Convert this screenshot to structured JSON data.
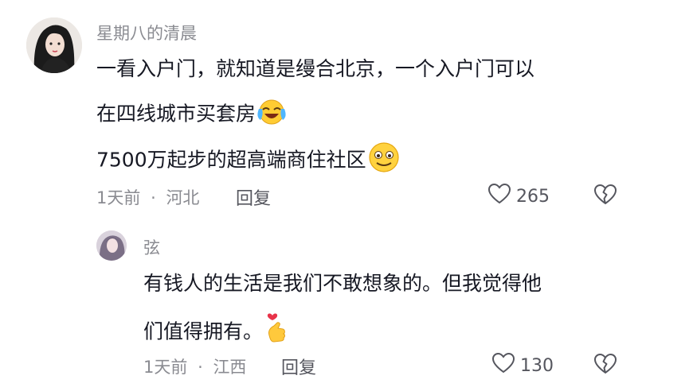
{
  "comments": [
    {
      "username": "星期八的清晨",
      "lines": [
        "一看入户门，就知道是缦合北京，一个入户门可以",
        "在四线城市买套房",
        "7500万起步的超高端商住社区"
      ],
      "time": "1天前",
      "location": "河北",
      "reply_label": "回复",
      "like_count": "265"
    },
    {
      "username": "弦",
      "lines": [
        "有钱人的生活是我们不敢想象的。但我觉得他",
        "们值得拥有。"
      ],
      "time": "1天前",
      "location": "江西",
      "reply_label": "回复",
      "like_count": "130"
    }
  ],
  "icons": [
    "heart-icon",
    "broken-heart-icon",
    "laughing-crying-emoji-icon",
    "smiling-emoji-icon",
    "finger-heart-emoji-icon"
  ],
  "separator": "·"
}
